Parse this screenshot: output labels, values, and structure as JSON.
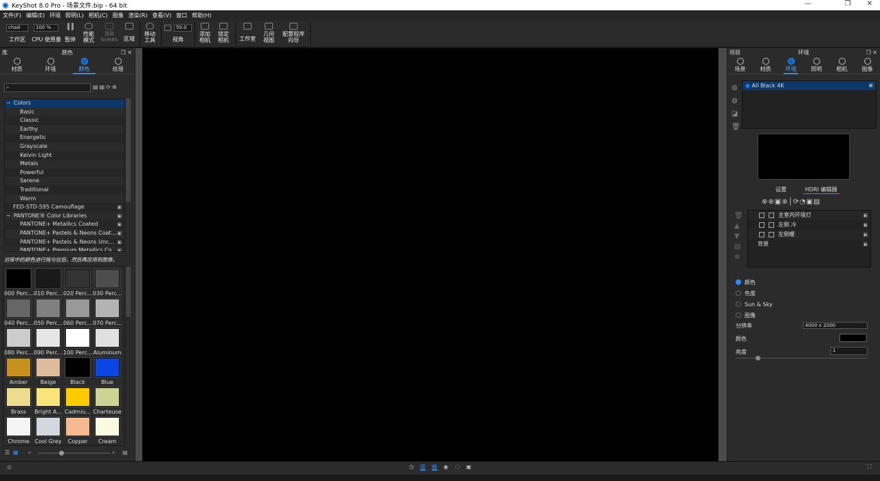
{
  "window": {
    "title": "KeyShot 8.0 Pro  - 场景文件.bip  - 64 bit",
    "minimize": "—",
    "maximize": "❐",
    "close": "✕"
  },
  "menu": [
    "文件(F)",
    "编辑(E)",
    "环境",
    "照明(L)",
    "相机(C)",
    "图像",
    "渲染(R)",
    "查看(V)",
    "窗口",
    "帮助(H)"
  ],
  "toolbar": {
    "workspace_value": "chad",
    "workspace_label": "工作区",
    "cpu_value": "100 %",
    "cpu_label": "CPU 使用量",
    "pause": "暂停",
    "perf_mode": "性能\n模式",
    "render_nurbs": "渲染\nNURBS",
    "region": "区域",
    "move_tool": "移动\n工具",
    "fov_value": "50.0",
    "fov_label": "视角",
    "add_camera": "添加\n相机",
    "lock_camera": "锁定\n相机",
    "studio": "工作室",
    "geometry_view": "几何\n视图",
    "config_wizard": "配置程序\n向导"
  },
  "library": {
    "title": "库",
    "panel_title": "颜色",
    "tabs": [
      {
        "label": "材质",
        "active": false
      },
      {
        "label": "环境",
        "active": false
      },
      {
        "label": "颜色",
        "active": true
      },
      {
        "label": "纹理",
        "active": false
      }
    ],
    "search_placeholder": "",
    "tree": [
      {
        "label": "Colors",
        "level": 0,
        "expanded": true,
        "selected": true
      },
      {
        "label": "Basic",
        "level": 1
      },
      {
        "label": "Classic",
        "level": 1
      },
      {
        "label": "Earthy",
        "level": 1
      },
      {
        "label": "Energetic",
        "level": 1
      },
      {
        "label": "Grayscale",
        "level": 1
      },
      {
        "label": "Kelvin Light",
        "level": 1
      },
      {
        "label": "Metals",
        "level": 1
      },
      {
        "label": "Powerful",
        "level": 1
      },
      {
        "label": "Serene",
        "level": 1
      },
      {
        "label": "Traditional",
        "level": 1
      },
      {
        "label": "Warm",
        "level": 1
      },
      {
        "label": "FED-STD-595 Camouflage",
        "level": 0,
        "locked": true
      },
      {
        "label": "PANTONE® Color Libraries",
        "level": 0,
        "expanded": true,
        "locked": true
      },
      {
        "label": "PANTONE+ Metallics Coated",
        "level": 1,
        "locked": true
      },
      {
        "label": "PANTONE+ Pastels & Neons Coat...",
        "level": 1,
        "locked": true
      },
      {
        "label": "PANTONE+ Pastels & Neons Unc...",
        "level": 1,
        "locked": true
      },
      {
        "label": "PANTONE+ Premium Metallics Co...",
        "level": 1,
        "locked": true
      }
    ],
    "hint": "对库中的颜色进行拖与拉后，然后再应用到图像。",
    "swatches": [
      {
        "label": "000 Perc...",
        "color": "#000000"
      },
      {
        "label": "010 Perc...",
        "color": "#1a1a1a"
      },
      {
        "label": "020 Perc...",
        "color": "#333333"
      },
      {
        "label": "030 Perc...",
        "color": "#4d4d4d"
      },
      {
        "label": "040 Perc...",
        "color": "#666666"
      },
      {
        "label": "050 Perc...",
        "color": "#808080"
      },
      {
        "label": "060 Perc...",
        "color": "#999999"
      },
      {
        "label": "070 Perc...",
        "color": "#b3b3b3"
      },
      {
        "label": "080 Perc...",
        "color": "#cccccc"
      },
      {
        "label": "090 Perc...",
        "color": "#e6e6e6"
      },
      {
        "label": "100 Perc...",
        "color": "#ffffff"
      },
      {
        "label": "Aluminum",
        "color": "#e0e0e0"
      },
      {
        "label": "Amber",
        "color": "#c8901c"
      },
      {
        "label": "Beige",
        "color": "#ddbb9c"
      },
      {
        "label": "Black",
        "color": "#000000"
      },
      {
        "label": "Blue",
        "color": "#0a46e6"
      },
      {
        "label": "Brass",
        "color": "#ecdc8e"
      },
      {
        "label": "Bright A...",
        "color": "#f8e57a"
      },
      {
        "label": "Cadmiu...",
        "color": "#fccb02"
      },
      {
        "label": "Charteuse",
        "color": "#cdd393"
      },
      {
        "label": "Chrome",
        "color": "#f5f5f5"
      },
      {
        "label": "Cool Grey",
        "color": "#d4d7de"
      },
      {
        "label": "Copper",
        "color": "#f5ba92"
      },
      {
        "label": "Cream",
        "color": "#fafae3"
      }
    ]
  },
  "project": {
    "title": "项目",
    "panel_title": "环境",
    "tabs": [
      {
        "label": "场景",
        "active": false
      },
      {
        "label": "材质",
        "active": false
      },
      {
        "label": "环境",
        "active": true
      },
      {
        "label": "照明",
        "active": false
      },
      {
        "label": "相机",
        "active": false
      },
      {
        "label": "图像",
        "active": false
      }
    ],
    "environment": "All Black 4K",
    "subtabs": [
      {
        "label": "设置",
        "active": false
      },
      {
        "label": "HDRI 编辑器",
        "active": true
      }
    ],
    "pins": [
      {
        "label": "主室内环境灯"
      },
      {
        "label": "左侧 冷"
      },
      {
        "label": "左侧暖"
      },
      {
        "label": "背景"
      }
    ],
    "background_options": [
      {
        "label": "颜色",
        "selected": true
      },
      {
        "label": "色度",
        "selected": false
      },
      {
        "label": "Sun & Sky",
        "selected": false
      },
      {
        "label": "图像",
        "selected": false
      }
    ],
    "resolution_label": "分辨率",
    "resolution_value": "4000 x 2000",
    "color_label": "颜色",
    "color_value": "#000000",
    "brightness_label": "亮度",
    "brightness_value": "1",
    "brightness_slider": 0.15
  },
  "accent": "#2b8cff"
}
